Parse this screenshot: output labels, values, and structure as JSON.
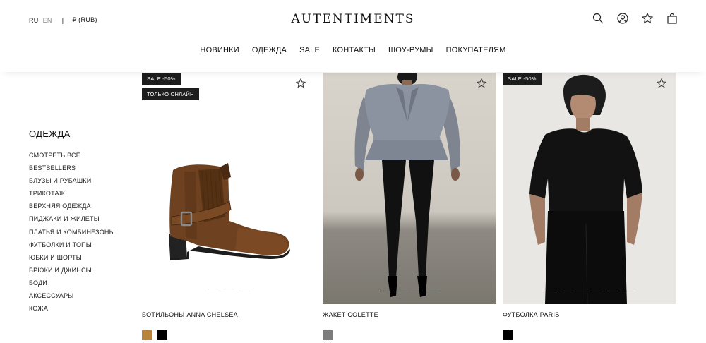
{
  "header": {
    "lang_ru": "RU",
    "lang_en": "EN",
    "separator": "|",
    "currency": "₽ (RUB)",
    "logo": "AUTENTIMENTS",
    "nav": [
      "НОВИНКИ",
      "ОДЕЖДА",
      "SALE",
      "КОНТАКТЫ",
      "ШОУ-РУМЫ",
      "ПОКУПАТЕЛЯМ"
    ],
    "icons": [
      "search-icon",
      "account-icon",
      "favorites-star-icon",
      "shopping-bag-icon"
    ]
  },
  "sidebar": {
    "heading": "ОДЕЖДА",
    "items": [
      "СМОТРЕТЬ ВСЁ",
      "BESTSELLERS",
      "БЛУЗЫ И РУБАШКИ",
      "ТРИКОТАЖ",
      "ВЕРХНЯЯ ОДЕЖДА",
      "ПИДЖАКИ И ЖИЛЕТЫ",
      "ПЛАТЬЯ И КОМБИНЕЗОНЫ",
      "ФУТБОЛКИ И ТОПЫ",
      "ЮБКИ И ШОРТЫ",
      "БРЮКИ И ДЖИНСЫ",
      "БОДИ",
      "АКСЕССУАРЫ",
      "КОЖА"
    ]
  },
  "products": [
    {
      "title": "БОТИЛЬОНЫ ANNA CHELSEA",
      "badges": [
        "SALE -50%",
        "ТОЛЬКО ОНЛАЙН"
      ],
      "swatches": [
        "#b8843b",
        "#000000"
      ],
      "slides": 3,
      "active_slide": 1
    },
    {
      "title": "ЖАКЕТ COLETTE",
      "badges": [],
      "swatches": [
        "#7d7d7d"
      ],
      "slides": 4,
      "active_slide": 1
    },
    {
      "title": "ФУТБОЛКА PARIS",
      "badges": [
        "SALE -50%"
      ],
      "swatches": [
        "#000000"
      ],
      "slides": 6,
      "active_slide": 1
    }
  ]
}
